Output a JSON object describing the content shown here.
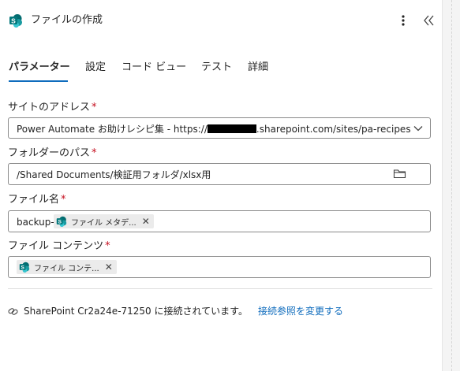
{
  "header": {
    "title": "ファイルの作成",
    "app_icon": "sharepoint-icon",
    "more_icon": "more-vertical-icon",
    "collapse_icon": "double-chevron-left-icon"
  },
  "tabs": [
    {
      "label": "パラメーター",
      "active": true
    },
    {
      "label": "設定",
      "active": false
    },
    {
      "label": "コード ビュー",
      "active": false
    },
    {
      "label": "テスト",
      "active": false
    },
    {
      "label": "詳細",
      "active": false
    }
  ],
  "fields": {
    "site_address": {
      "label": "サイトのアドレス",
      "required_mark": "*",
      "value_prefix": "Power Automate お助けレシピ集 - https://",
      "value_suffix": ".sharepoint.com/sites/pa-recipes"
    },
    "folder_path": {
      "label": "フォルダーのパス",
      "required_mark": "*",
      "value": "/Shared Documents/検証用フォルダ/xlsx用"
    },
    "file_name": {
      "label": "ファイル名",
      "required_mark": "*",
      "text_prefix": "backup-",
      "token_label": "ファイル メタデ...",
      "token_remove": "✕"
    },
    "file_content": {
      "label": "ファイル コンテンツ",
      "required_mark": "*",
      "token_label": "ファイル コンテ...",
      "token_remove": "✕"
    }
  },
  "connection": {
    "status_text": "SharePoint Cr2a24e-71250 に接続されています。",
    "change_link": "接続参照を変更する"
  },
  "colors": {
    "accent": "#0f6cbd",
    "required": "#c50f1f",
    "sharepoint_teal": "#038387"
  }
}
